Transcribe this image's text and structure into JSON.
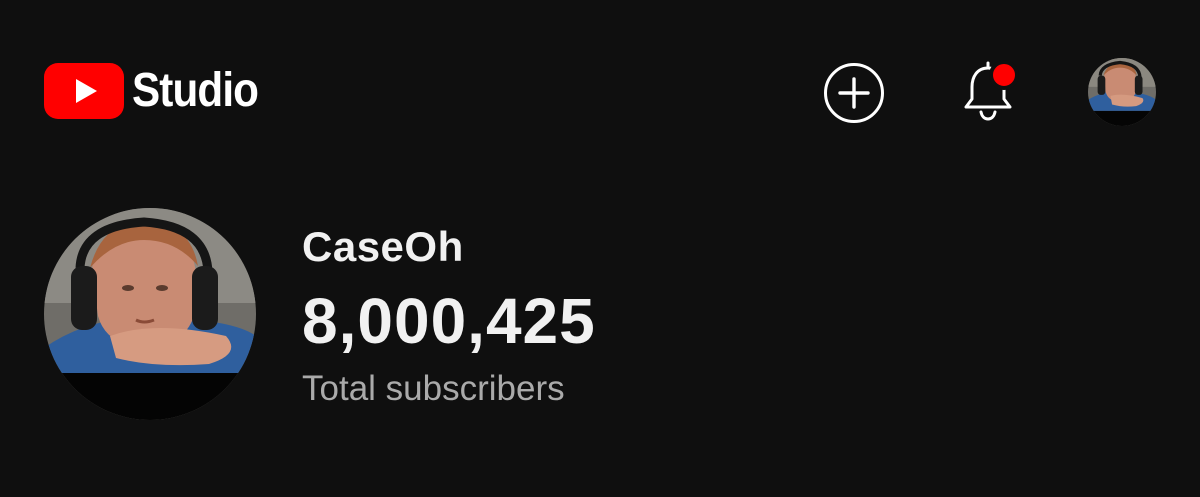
{
  "header": {
    "logo_text": "Studio",
    "logo_icon": "youtube-play-icon",
    "create_icon": "plus-circle-icon",
    "notifications_icon": "bell-icon",
    "notifications_badge_color": "#ff0000",
    "account_icon": "avatar"
  },
  "channel": {
    "name": "CaseOh",
    "subscriber_count": "8,000,425",
    "subscriber_label": "Total subscribers"
  },
  "colors": {
    "background": "#0f0f0f",
    "brand_red": "#ff0000",
    "text_primary": "#f1f1f1",
    "text_secondary": "#aaaaaa"
  }
}
